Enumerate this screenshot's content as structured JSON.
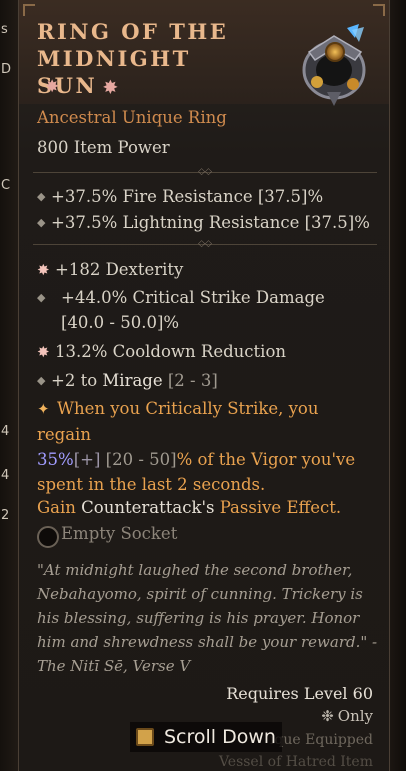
{
  "edge_numbers": [
    "s",
    "D",
    "C",
    "4",
    "4",
    "2"
  ],
  "item": {
    "name": "RING OF THE MIDNIGHT SUN",
    "type_line": "Ancestral Unique Ring",
    "item_power": "800 Item Power"
  },
  "implicits": [
    "+37.5% Fire Resistance [37.5]%",
    "+37.5% Lightning Resistance [37.5]%"
  ],
  "affixes": {
    "dexterity": "+182 Dexterity",
    "crit_damage": "+44.0% Critical Strike Damage [40.0 - 50.0]%",
    "cooldown": "13.2% Cooldown Reduction",
    "mirage_prefix": "+2 to ",
    "mirage_skill": "Mirage",
    "mirage_range": " [2 - 3]"
  },
  "unique_power": {
    "line1": "When you Critically Strike, you regain",
    "value": "35%",
    "plus": "[+]",
    "range": " [20 - 50]",
    "line2_rest": "% of the Vigor you've",
    "line3": "spent in the last 2 seconds.",
    "gain_word": "Gain ",
    "skill": "Counterattack's",
    "passive": " Passive Effect."
  },
  "socket_label": "Empty Socket",
  "flavor_text": "\"At midnight laughed the second brother, Nebahayomo, spirit of cunning. Trickery is his blessing, suffering is his prayer. Honor him and shrewdness shall be your reward.\" - The Nitī Sē, Verse V",
  "requirements": {
    "level": "Requires Level 60",
    "class_only": "Only",
    "unique_equipped": "ique Equipped",
    "vessel_line": "Vessel of Hatred Item"
  },
  "scroll_hint": "Scroll Down",
  "colors": {
    "title": "#e9b88c",
    "unique_orange": "#d08b4e",
    "highlight_purple": "#a19cff",
    "gold_text": "#e9a24f"
  }
}
